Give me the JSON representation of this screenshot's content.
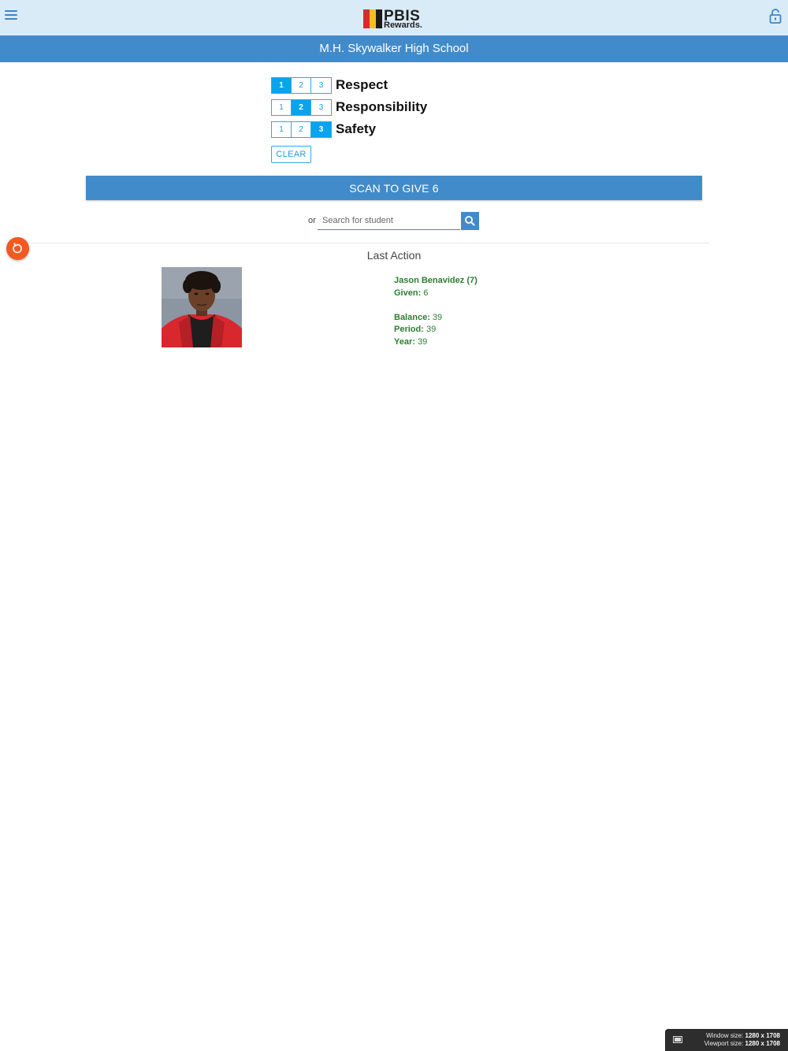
{
  "header": {
    "menu_icon": "hamburger-menu-icon",
    "lock_icon": "lock-icon",
    "logo": {
      "main": "PBIS",
      "sub": "Rewards."
    }
  },
  "school": {
    "name": "M.H. Skywalker High School"
  },
  "behaviors": [
    {
      "label": "Respect",
      "options": [
        "1",
        "2",
        "3"
      ],
      "selected": "1"
    },
    {
      "label": "Responsibility",
      "options": [
        "1",
        "2",
        "3"
      ],
      "selected": "2"
    },
    {
      "label": "Safety",
      "options": [
        "1",
        "2",
        "3"
      ],
      "selected": "3"
    }
  ],
  "clear_label": "CLEAR",
  "scan_label": "SCAN TO GIVE 6",
  "search": {
    "or_label": "or",
    "placeholder": "Search for student"
  },
  "last_action": {
    "title": "Last Action",
    "student_name": "Jason Benavidez (7)",
    "given_label": "Given:",
    "given_value": "6",
    "balance_label": "Balance:",
    "balance_value": "39",
    "period_label": "Period:",
    "period_value": "39",
    "year_label": "Year:",
    "year_value": "39"
  },
  "window_badge": {
    "window_label": "Window size:",
    "window_value": "1280 x 1708",
    "viewport_label": "Viewport size:",
    "viewport_value": "1280 x 1708"
  },
  "colors": {
    "header_bg": "#d9ebf7",
    "primary": "#428bca",
    "accent": "#0aa3ee",
    "details_text": "#2e7d32",
    "refresh": "#f25a22"
  }
}
